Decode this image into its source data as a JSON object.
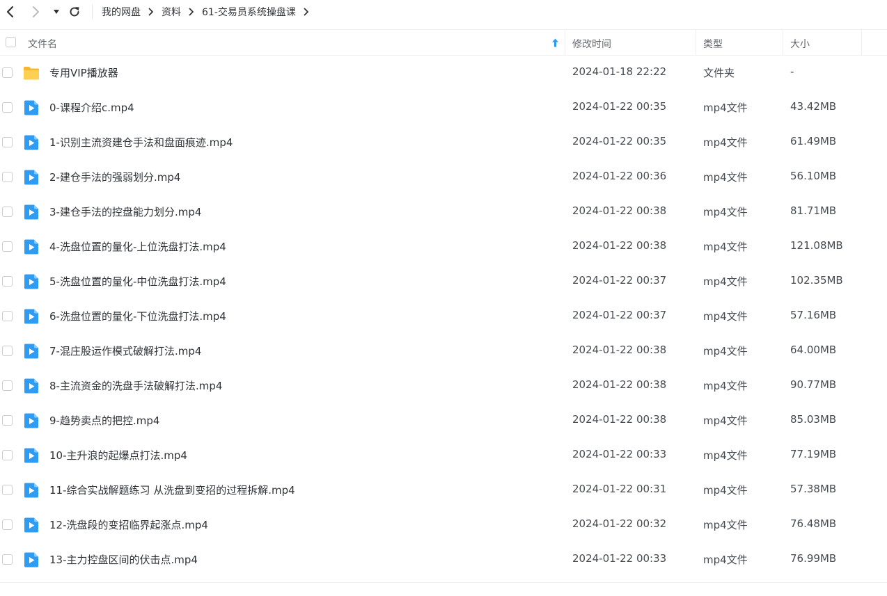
{
  "breadcrumb": [
    "我的网盘",
    "资料",
    "61-交易员系统操盘课"
  ],
  "columns": {
    "name": "文件名",
    "modified": "修改时间",
    "type": "类型",
    "size": "大小"
  },
  "files": [
    {
      "name": "专用VIP播放器",
      "modified": "2024-01-18 22:22",
      "type": "文件夹",
      "size": "-",
      "icon": "folder-icon"
    },
    {
      "name": "0-课程介绍c.mp4",
      "modified": "2024-01-22 00:35",
      "type": "mp4文件",
      "size": "43.42MB",
      "icon": "video-icon"
    },
    {
      "name": "1-识别主流资建仓手法和盘面痕迹.mp4",
      "modified": "2024-01-22 00:35",
      "type": "mp4文件",
      "size": "61.49MB",
      "icon": "video-icon"
    },
    {
      "name": "2-建仓手法的强弱划分.mp4",
      "modified": "2024-01-22 00:36",
      "type": "mp4文件",
      "size": "56.10MB",
      "icon": "video-icon"
    },
    {
      "name": "3-建仓手法的控盘能力划分.mp4",
      "modified": "2024-01-22 00:38",
      "type": "mp4文件",
      "size": "81.71MB",
      "icon": "video-icon"
    },
    {
      "name": "4-洗盘位置的量化-上位洗盘打法.mp4",
      "modified": "2024-01-22 00:38",
      "type": "mp4文件",
      "size": "121.08MB",
      "icon": "video-icon"
    },
    {
      "name": "5-洗盘位置的量化-中位洗盘打法.mp4",
      "modified": "2024-01-22 00:37",
      "type": "mp4文件",
      "size": "102.35MB",
      "icon": "video-icon"
    },
    {
      "name": "6-洗盘位置的量化-下位洗盘打法.mp4",
      "modified": "2024-01-22 00:37",
      "type": "mp4文件",
      "size": "57.16MB",
      "icon": "video-icon"
    },
    {
      "name": "7-混庄股运作模式破解打法.mp4",
      "modified": "2024-01-22 00:38",
      "type": "mp4文件",
      "size": "64.00MB",
      "icon": "video-icon"
    },
    {
      "name": "8-主流资金的洗盘手法破解打法.mp4",
      "modified": "2024-01-22 00:38",
      "type": "mp4文件",
      "size": "90.77MB",
      "icon": "video-icon"
    },
    {
      "name": "9-趋势卖点的把控.mp4",
      "modified": "2024-01-22 00:38",
      "type": "mp4文件",
      "size": "85.03MB",
      "icon": "video-icon"
    },
    {
      "name": "10-主升浪的起爆点打法.mp4",
      "modified": "2024-01-22 00:33",
      "type": "mp4文件",
      "size": "77.19MB",
      "icon": "video-icon"
    },
    {
      "name": "11-综合实战解题练习 从洗盘到变招的过程拆解.mp4",
      "modified": "2024-01-22 00:31",
      "type": "mp4文件",
      "size": "57.38MB",
      "icon": "video-icon"
    },
    {
      "name": "12-洗盘段的变招临界起涨点.mp4",
      "modified": "2024-01-22 00:32",
      "type": "mp4文件",
      "size": "76.48MB",
      "icon": "video-icon"
    },
    {
      "name": "13-主力控盘区间的伏击点.mp4",
      "modified": "2024-01-22 00:33",
      "type": "mp4文件",
      "size": "76.99MB",
      "icon": "video-icon"
    }
  ],
  "colors": {
    "accent": "#2f9cf3",
    "folder": "#f7c244",
    "text": "#2f3338",
    "muted": "#62666c"
  }
}
